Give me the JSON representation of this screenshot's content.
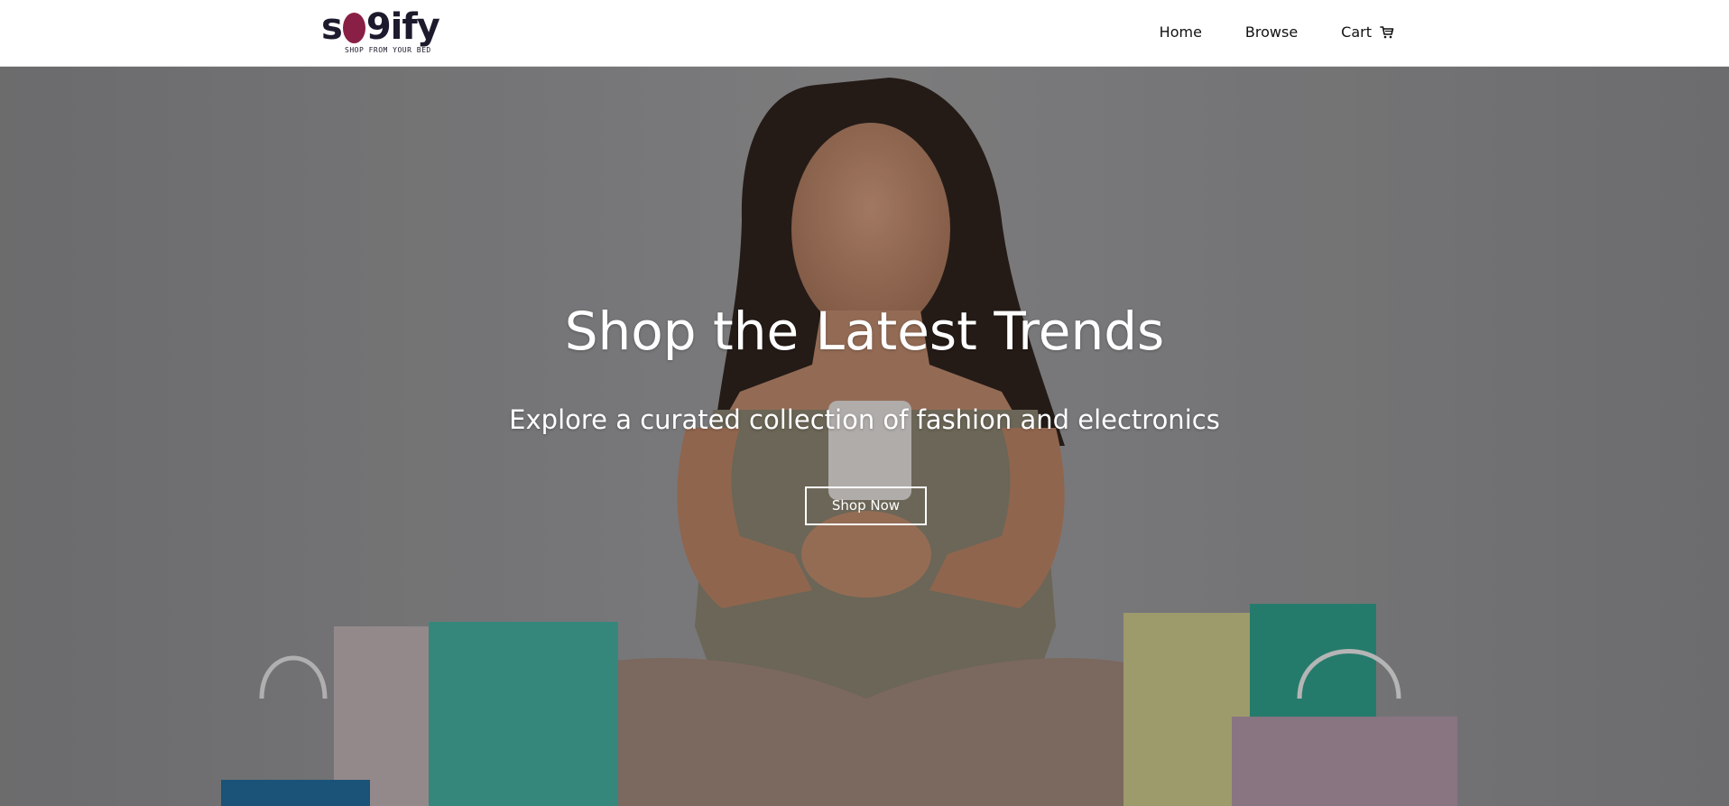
{
  "brand": {
    "logo_text_left": "s",
    "logo_text_right": "9ify",
    "tagline": "SHOP FROM YOUR BED",
    "logo_accent_color": "#8a1f45",
    "logo_dark_color": "#1c1a2c"
  },
  "nav": {
    "items": [
      {
        "label": "Home"
      },
      {
        "label": "Browse"
      },
      {
        "label": "Cart",
        "icon": "shopping-cart-icon"
      }
    ]
  },
  "hero": {
    "title": "Shop the Latest Trends",
    "subtitle": "Explore a curated collection of fashion and electronics",
    "cta_label": "Shop Now",
    "image_description_icon": "woman-with-phone-and-shopping-bags-photo"
  }
}
